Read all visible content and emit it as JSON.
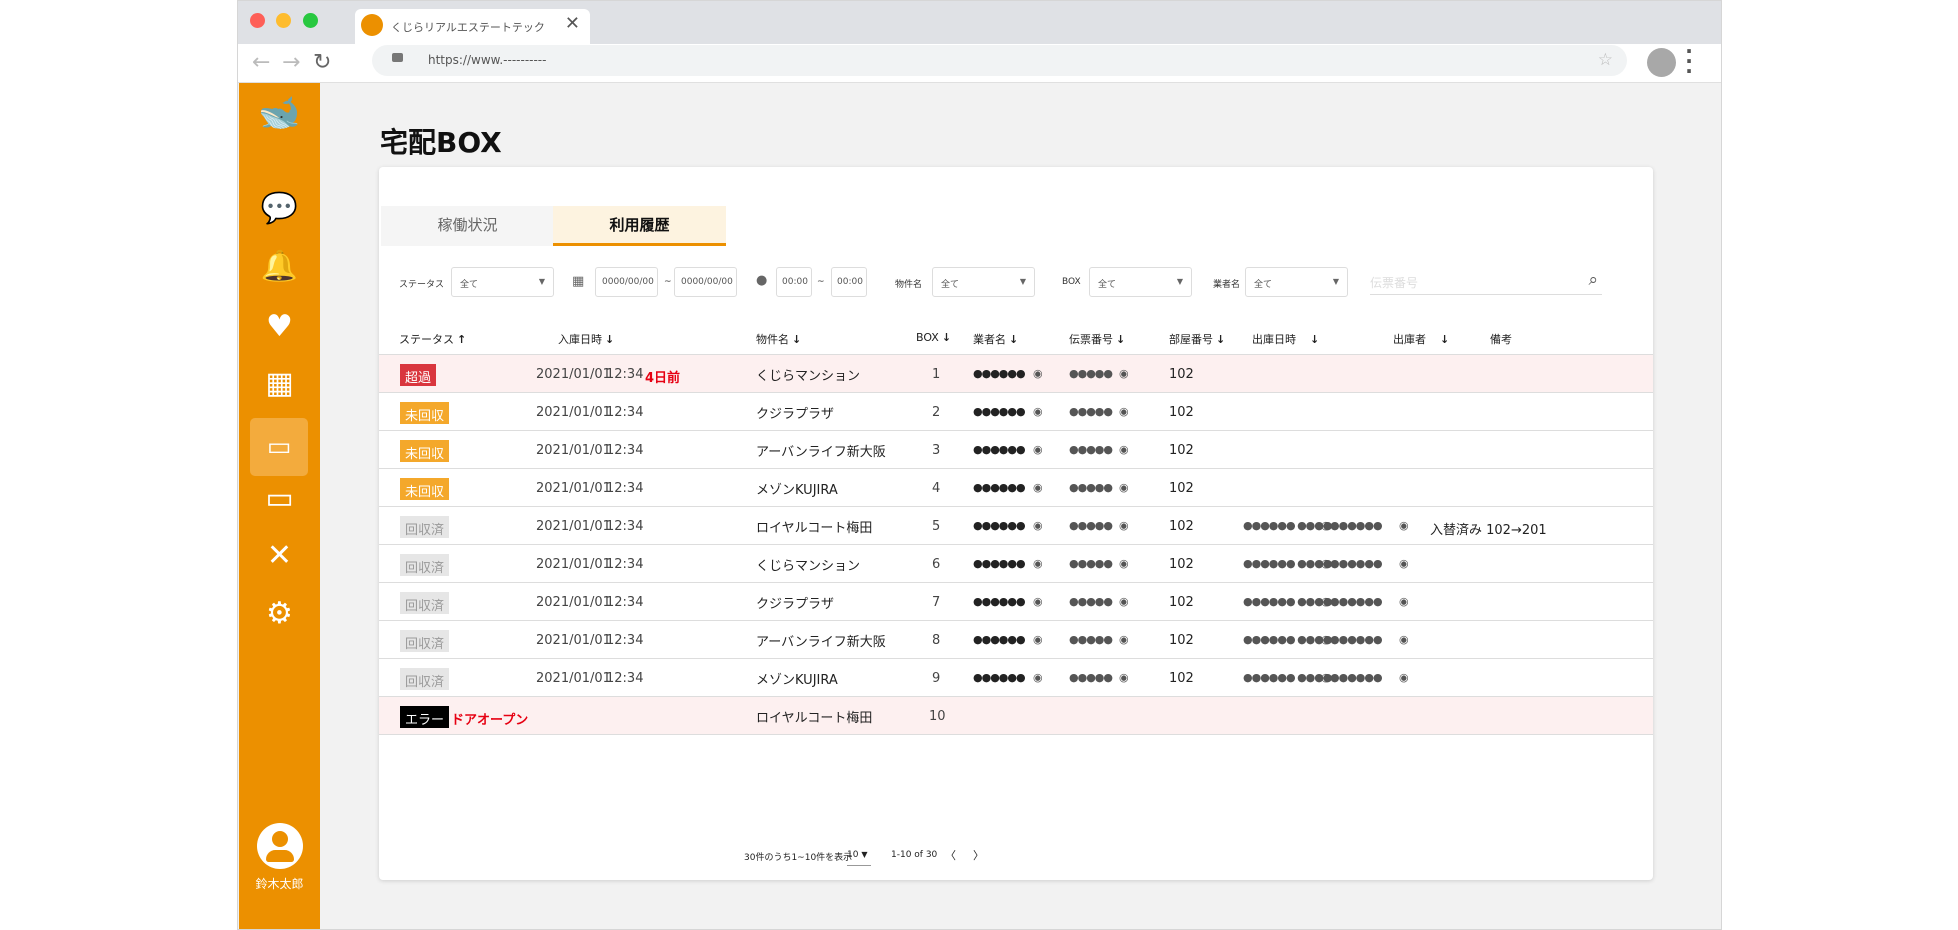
{
  "browser": {
    "tab_title": "くじらリアルエステートテック",
    "url": "https://www.----------"
  },
  "sidebar": {
    "user_name": "鈴木太郎",
    "items": [
      "chat",
      "notifications",
      "favorites",
      "buildings",
      "delivery-box",
      "payment",
      "maintenance",
      "settings"
    ],
    "active": "delivery-box"
  },
  "page": {
    "title": "宅配BOX"
  },
  "tabs": [
    {
      "label": "稼働状況"
    },
    {
      "label": "利用履歴",
      "active": true
    }
  ],
  "filters": {
    "status_label": "ステータス",
    "status_value": "全て",
    "date_from": "0000/00/00",
    "date_sep": "~",
    "date_to": "0000/00/00",
    "time_from": "00:00",
    "time_sep": "~",
    "time_to": "00:00",
    "property_label": "物件名",
    "property_value": "全て",
    "box_label": "BOX",
    "box_value": "全て",
    "vendor_label": "業者名",
    "vendor_value": "全て",
    "search_placeholder": "伝票番号"
  },
  "columns": [
    {
      "label": "ステータス",
      "sort": "↑"
    },
    {
      "label": "入庫日時",
      "sort": "↓"
    },
    {
      "label": "物件名",
      "sort": "↓"
    },
    {
      "label": "BOX",
      "sort": "↓"
    },
    {
      "label": "業者名",
      "sort": "↓"
    },
    {
      "label": "伝票番号",
      "sort": "↓"
    },
    {
      "label": "部屋番号",
      "sort": "↓"
    },
    {
      "label": "出庫日時",
      "sort": "↓"
    },
    {
      "label": "出庫者",
      "sort": "↓"
    },
    {
      "label": "備考",
      "sort": ""
    }
  ],
  "rows": [
    {
      "status": "超過",
      "type": "over",
      "date": "2021/01/01",
      "time": "12:34",
      "overdue": "4日前",
      "property": "くじらマンション",
      "box": "1",
      "vendor": "●●●●●●",
      "slip": "●●●●●",
      "room": "102",
      "out_date": "",
      "out_person": "",
      "note": ""
    },
    {
      "status": "未回収",
      "type": "pend",
      "date": "2021/01/01",
      "time": "12:34",
      "property": "クジラプラザ",
      "box": "2",
      "vendor": "●●●●●●",
      "slip": "●●●●●",
      "room": "102",
      "out_date": "",
      "out_person": "",
      "note": ""
    },
    {
      "status": "未回収",
      "type": "pend",
      "date": "2021/01/01",
      "time": "12:34",
      "property": "アーバンライフ新大阪",
      "box": "3",
      "vendor": "●●●●●●",
      "slip": "●●●●●",
      "room": "102",
      "out_date": "",
      "out_person": "",
      "note": ""
    },
    {
      "status": "未回収",
      "type": "pend",
      "date": "2021/01/01",
      "time": "12:34",
      "property": "メゾンKUJIRA",
      "box": "4",
      "vendor": "●●●●●●",
      "slip": "●●●●●",
      "room": "102",
      "out_date": "",
      "out_person": "",
      "note": ""
    },
    {
      "status": "回収済",
      "type": "done",
      "date": "2021/01/01",
      "time": "12:34",
      "property": "ロイヤルコート梅田",
      "box": "5",
      "vendor": "●●●●●●",
      "slip": "●●●●●",
      "room": "102",
      "out_date": "●●●●●● ●●●●",
      "out_person": "●●●●●●",
      "note": "入替済み  102→201"
    },
    {
      "status": "回収済",
      "type": "done",
      "date": "2021/01/01",
      "time": "12:34",
      "property": "くじらマンション",
      "box": "6",
      "vendor": "●●●●●●",
      "slip": "●●●●●",
      "room": "102",
      "out_date": "●●●●●● ●●●●",
      "out_person": "●●●●●●",
      "note": ""
    },
    {
      "status": "回収済",
      "type": "done",
      "date": "2021/01/01",
      "time": "12:34",
      "property": "クジラプラザ",
      "box": "7",
      "vendor": "●●●●●●",
      "slip": "●●●●●",
      "room": "102",
      "out_date": "●●●●●● ●●●●",
      "out_person": "●●●●●●",
      "note": ""
    },
    {
      "status": "回収済",
      "type": "done",
      "date": "2021/01/01",
      "time": "12:34",
      "property": "アーバンライフ新大阪",
      "box": "8",
      "vendor": "●●●●●●",
      "slip": "●●●●●",
      "room": "102",
      "out_date": "●●●●●● ●●●●",
      "out_person": "●●●●●●",
      "note": ""
    },
    {
      "status": "回収済",
      "type": "done",
      "date": "2021/01/01",
      "time": "12:34",
      "property": "メゾンKUJIRA",
      "box": "9",
      "vendor": "●●●●●●",
      "slip": "●●●●●",
      "room": "102",
      "out_date": "●●●●●● ●●●●",
      "out_person": "●●●●●●",
      "note": ""
    },
    {
      "status": "エラー",
      "type": "err",
      "error_text": "ドアオープン",
      "date": "",
      "time": "",
      "property": "ロイヤルコート梅田",
      "box": "10",
      "vendor": "",
      "slip": "",
      "room": "",
      "out_date": "",
      "out_person": "",
      "note": ""
    }
  ],
  "pagination": {
    "summary": "30件のうち1~10件を表示",
    "per_page": "10",
    "range": "1-10 of 30",
    "prev": "〈",
    "next": "〉"
  },
  "colors": {
    "accent": "#ec9000",
    "over": "#d9363e",
    "pending": "#f4a82b",
    "error_text": "#e60012",
    "alert_row": "#fdf0f0"
  }
}
